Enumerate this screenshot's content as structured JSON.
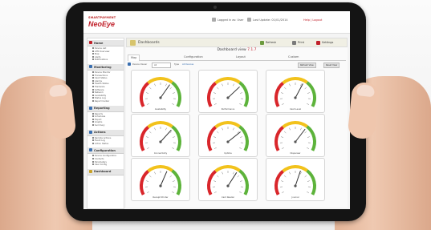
{
  "brand": {
    "small_text": "SMARTPAYMENT",
    "logo": "NeoEye"
  },
  "topbar": {
    "items": [
      {
        "label": "Logged in as: User",
        "color": "#555555"
      },
      {
        "label": "Last Update: 01/01/2014",
        "color": "#555555"
      },
      {
        "label": "Help | Logout",
        "color": "#c0202a"
      }
    ]
  },
  "sidebar": {
    "sections": [
      {
        "title": "Home",
        "icon": "home-icon",
        "color": "#c0202a",
        "items": [
          "Device List",
          "ATM Overview",
          "Map",
          "Alerts",
          "Notifications"
        ]
      },
      {
        "title": "Monitoring",
        "icon": "monitor-icon",
        "color": "#3a6fb0",
        "items": [
          "Device Monitor",
          "Transactions",
          "Cash Status",
          "Alarms",
          "Health Status",
          "Hardware",
          "Software",
          "Network",
          "Availability",
          "Status Log",
          "Report Center"
        ]
      },
      {
        "title": "Reporting",
        "icon": "report-icon",
        "color": "#3a6fb0",
        "items": [
          "Reports",
          "Schedules",
          "Export",
          "Graphs",
          "Summary"
        ]
      },
      {
        "title": "Actions",
        "icon": "action-icon",
        "color": "#3a6fb0",
        "items": [
          "Remote Actions",
          "Event Log",
          "Action Status"
        ]
      },
      {
        "title": "Configuration",
        "icon": "config-icon",
        "color": "#3a6fb0",
        "items": [
          "Device Configuration",
          "Contacts",
          "Parameters",
          "User Config"
        ]
      },
      {
        "title": "Dashboard",
        "icon": "dashboard-icon",
        "color": "#c9a227",
        "items": []
      }
    ]
  },
  "main": {
    "breadcrumb": "Dashboards",
    "right_buttons": [
      "Refresh",
      "Print",
      "Settings"
    ],
    "title_prefix": "Dashboard view",
    "title_version": "7.1.7",
    "tabs": [
      "Map",
      "Configuration",
      "Layout",
      "Custom"
    ],
    "filters": {
      "label1": "Device Owner",
      "select1": "All",
      "label2": "Type",
      "select2": "All Devices",
      "buttons": [
        "Refresh View",
        "Reset View"
      ]
    }
  },
  "gauges": [
    {
      "label": "Availability",
      "value": 0.65
    },
    {
      "label": "Performance",
      "value": 0.7
    },
    {
      "label": "Cash Level",
      "value": 0.62
    },
    {
      "label": "Connectivity",
      "value": 0.68
    },
    {
      "label": "Uptime",
      "value": 0.72
    },
    {
      "label": "Dispenser",
      "value": 0.66
    },
    {
      "label": "Receipt Printer",
      "value": 0.6
    },
    {
      "label": "Card Reader",
      "value": 0.64
    },
    {
      "label": "Journal",
      "value": 0.58
    }
  ],
  "colors": {
    "brand_red": "#c0202a",
    "gauge_red": "#d9262b",
    "gauge_yellow": "#f2c21c",
    "gauge_green": "#5db33b"
  }
}
